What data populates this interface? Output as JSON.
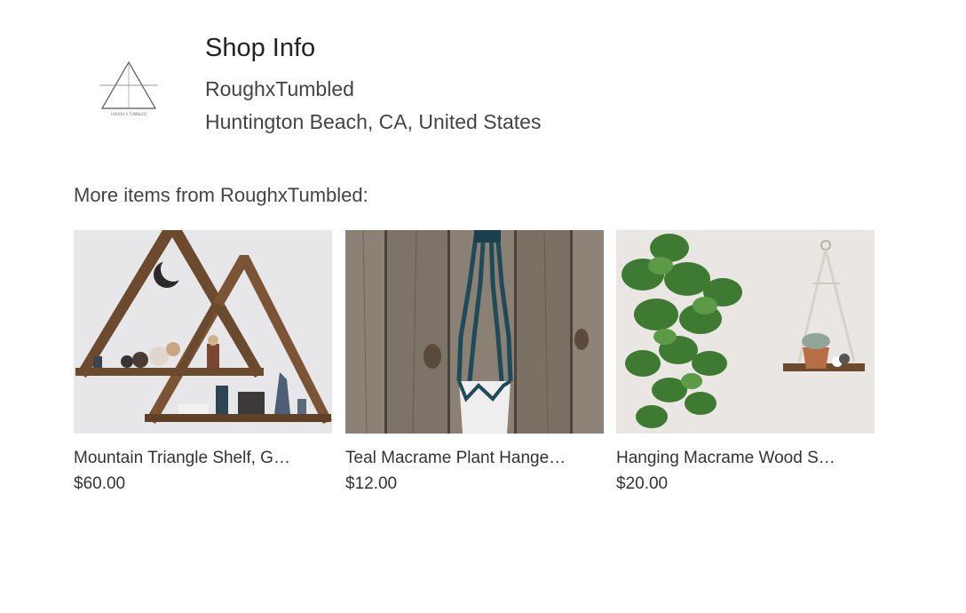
{
  "shop": {
    "heading": "Shop Info",
    "name": "RoughxTumbled",
    "location": "Huntington Beach, CA, United States",
    "logo_icon": "triangle-logo-icon",
    "logo_text": "ROUGH X TUMBLED"
  },
  "more_items": {
    "heading": "More items from RoughxTumbled:",
    "items": [
      {
        "title": "Mountain Triangle Shelf, G…",
        "price": "$60.00",
        "image_icon": "triangle-shelf-photo"
      },
      {
        "title": "Teal Macrame Plant Hange…",
        "price": "$12.00",
        "image_icon": "macrame-hanger-photo"
      },
      {
        "title": "Hanging Macrame Wood S…",
        "price": "$20.00",
        "image_icon": "hanging-shelf-photo"
      }
    ]
  },
  "colors": {
    "text_dark": "#222222",
    "text_body": "#444444",
    "macrame_teal": "#1f4a5a",
    "wood_brown": "#6b4a2e"
  }
}
